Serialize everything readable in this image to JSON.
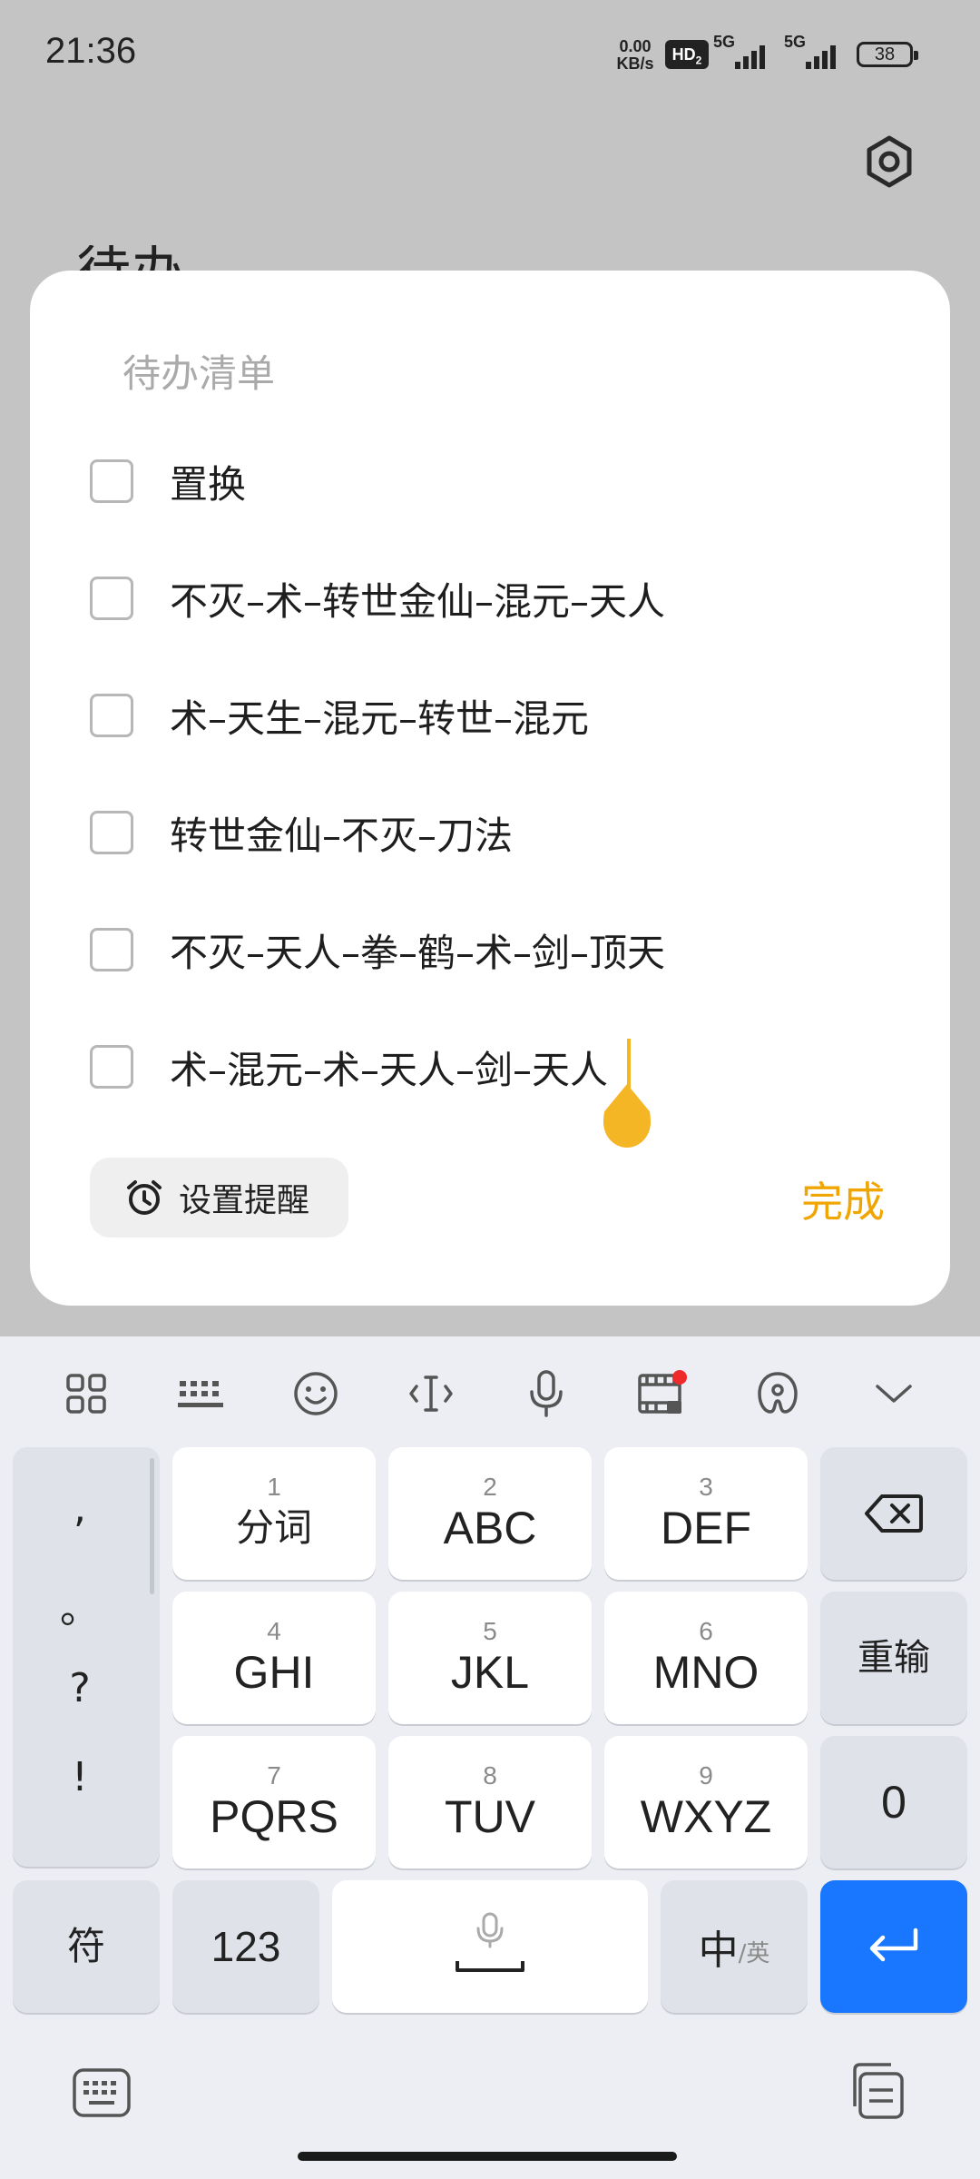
{
  "status_bar": {
    "time": "21:36",
    "speed_value": "0.00",
    "speed_unit": "KB/s",
    "hd_label": "HD",
    "hd_sub": "2",
    "net1": "5G",
    "net2": "5G",
    "battery": "38"
  },
  "background": {
    "title_partial": "待办"
  },
  "dialog": {
    "title": "待办清单",
    "items": [
      {
        "text": "置换",
        "checked": false
      },
      {
        "text": "不灭–术–转世金仙–混元–天人",
        "checked": false
      },
      {
        "text": "术–天生–混元–转世–混元",
        "checked": false
      },
      {
        "text": "转世金仙–不灭–刀法",
        "checked": false
      },
      {
        "text": "不灭–天人–拳–鹤–术–剑–顶天",
        "checked": false
      },
      {
        "text": "术–混元–术–天人–剑–天人",
        "checked": false
      }
    ],
    "reminder_label": "设置提醒",
    "done_label": "完成",
    "accent_color": "#f0a500",
    "cursor_color": "#f5b625"
  },
  "keyboard": {
    "toolbar_icons": [
      "apps-grid-icon",
      "keyboard-icon",
      "emoji-icon",
      "cursor-move-icon",
      "microphone-icon",
      "video-mi-icon",
      "handwriting-icon",
      "chevron-down-icon"
    ],
    "punctuation": [
      ",",
      "。",
      "?",
      "!"
    ],
    "keys": {
      "k1": {
        "num": "1",
        "label": "分词"
      },
      "k2": {
        "num": "2",
        "label": "ABC"
      },
      "k3": {
        "num": "3",
        "label": "DEF"
      },
      "k4": {
        "num": "4",
        "label": "GHI"
      },
      "k5": {
        "num": "5",
        "label": "JKL"
      },
      "k6": {
        "num": "6",
        "label": "MNO"
      },
      "k7": {
        "num": "7",
        "label": "PQRS"
      },
      "k8": {
        "num": "8",
        "label": "TUV"
      },
      "k9": {
        "num": "9",
        "label": "WXYZ"
      }
    },
    "reset_label": "重输",
    "zero_label": "0",
    "symbol_label": "符",
    "numbers_label": "123",
    "lang_main": "中",
    "lang_sub": "/英",
    "enter_color": "#1977ff"
  }
}
